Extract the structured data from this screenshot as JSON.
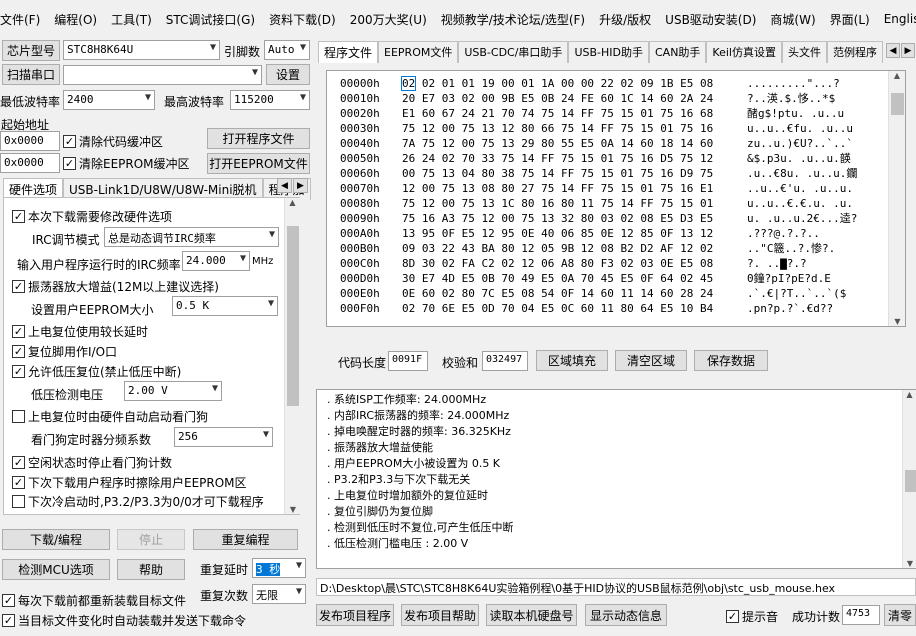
{
  "menu": [
    "文件(F)",
    "编程(O)",
    "工具(T)",
    "STC调试接口(G)",
    "资料下载(D)",
    "200万大奖(U)",
    "视频教学/技术论坛/选型(F)",
    "升级/版权",
    "USB驱动安装(D)",
    "商城(W)",
    "界面(L)",
    "English"
  ],
  "left": {
    "chip_btn": "芯片型号",
    "chip_val": "STC8H8K64U",
    "pins_lbl": "引脚数",
    "pins_val": "Auto",
    "scan_btn": "扫描串口",
    "port_val": "",
    "settings_btn": "设置",
    "min_baud_lbl": "最低波特率",
    "min_baud": "2400",
    "max_baud_lbl": "最高波特率",
    "max_baud": "115200",
    "start_addr_lbl": "起始地址",
    "addr1": "0x0000",
    "clear_code": "清除代码缓冲区",
    "open_prog": "打开程序文件",
    "addr2": "0x0000",
    "clear_eeprom": "清除EEPROM缓冲区",
    "open_eeprom": "打开EEPROM文件",
    "tabs": [
      "硬件选项",
      "USB-Link1D/U8W/U8W-Mini脱机",
      "程序加"
    ],
    "opts": {
      "o1": "本次下载需要修改硬件选项",
      "irc_mode_lbl": "IRC调节模式",
      "irc_mode": "总是动态调节IRC频率",
      "irc_freq_lbl": "输入用户程序运行时的IRC频率",
      "irc_freq": "24.000",
      "mhz": "MHz",
      "o2": "振荡器放大增益(12M以上建议选择)",
      "eeprom_size_lbl": "设置用户EEPROM大小",
      "eeprom_size": "0.5 K",
      "o3": "上电复位使用较长延时",
      "o4": "复位脚用作I/O口",
      "o5": "允许低压复位(禁止低压中断)",
      "lv_lbl": "低压检测电压",
      "lv": "2.00 V",
      "o6": "上电复位时由硬件自动启动看门狗",
      "wdt_lbl": "看门狗定时器分频系数",
      "wdt": "256",
      "o7": "空闲状态时停止看门狗计数",
      "o8": "下次下载用户程序时擦除用户EEPROM区",
      "o9": "下次冷启动时,P3.2/P3.3为0/0才可下载程序"
    },
    "download_btn": "下载/编程",
    "stop_btn": "停止",
    "reprog_btn": "重复编程",
    "detect_btn": "检测MCU选项",
    "help_btn": "帮助",
    "delay_lbl": "重复延时",
    "delay_val": "3 秒",
    "count_lbl": "重复次数",
    "count_val": "无限",
    "reload_each": "每次下载前都重新装载目标文件",
    "auto_send": "当目标文件变化时自动装载并发送下载命令"
  },
  "right": {
    "tabs": [
      "程序文件",
      "EEPROM文件",
      "USB-CDC/串口助手",
      "USB-HID助手",
      "CAN助手",
      "Keil仿真设置",
      "头文件",
      "范例程序"
    ],
    "hex_rows": [
      {
        "a": "00000h",
        "b": "02 02 01 01 19 00 01 1A 00 00 22 02 09 1B E5 08",
        "c": ".........\"...?"
      },
      {
        "a": "00010h",
        "b": "20 E7 03 02 00 9B E5 0B 24 FE 60 1C 14 60 2A 24",
        "c": " ?..渶.$.恀..*$"
      },
      {
        "a": "00020h",
        "b": "E1 60 67 24 21 70 74 75 14 FF 75 15 01 75 16 68",
        "c": "醏g$!ptu. .u..u"
      },
      {
        "a": "00030h",
        "b": "75 12 00 75 13 12 80 66 75 14 FF 75 15 01 75 16",
        "c": "u..u..€fu. .u..u"
      },
      {
        "a": "00040h",
        "b": "7A 75 12 00 75 13 29 80 55 E5 0A 14 60 18 14 60",
        "c": "zu..u.)€U?..`..`"
      },
      {
        "a": "00050h",
        "b": "26 24 02 70 33 75 14 FF 75 15 01 75 16 D5 75 12",
        "c": "&$.p3u. .u..u.韺"
      },
      {
        "a": "00060h",
        "b": "00 75 13 04 80 38 75 14 FF 75 15 01 75 16 D9 75",
        "c": ".u..€8u. .u..u.鑭"
      },
      {
        "a": "00070h",
        "b": "12 00 75 13 08 80 27 75 14 FF 75 15 01 75 16 E1",
        "c": "..u..€'u. .u..u."
      },
      {
        "a": "00080h",
        "b": "75 12 00 75 13 1C 80 16 80 11 75 14 FF 75 15 01",
        "c": "u..u..€.€.u. .u."
      },
      {
        "a": "00090h",
        "b": "75 16 A3 75 12 00 75 13 32 80 03 02 08 E5 D3 E5",
        "c": "u. .u..u.2€...逵?"
      },
      {
        "a": "000A0h",
        "b": "13 95 0F E5 12 95 0E 40 06 85 0E 12 85 0F 13 12",
        "c": ".???@.?.?.."
      },
      {
        "a": "000B0h",
        "b": "09 03 22 43 BA 80 12 05 9B 12 08 B2 D2 AF 12 02",
        "c": "..\"C簚..?.惨?."
      },
      {
        "a": "000C0h",
        "b": "8D 30 02 FA C2 02 12 06 A8 80 F3 02 03 0E E5 08",
        "c": "?.  ..▇?.?"
      },
      {
        "a": "000D0h",
        "b": "30 E7 4D E5 0B 70 49 E5 0A 70 45 E5 0F 64 02 45",
        "c": "0鐘?pI?pE?d.E"
      },
      {
        "a": "000E0h",
        "b": "0E 60 02 80 7C E5 08 54 0F 14 60 11 14 60 28 24",
        "c": ".`.€|?T..`..`($"
      },
      {
        "a": "000F0h",
        "b": "02 70 6E E5 0D 70 04 E5 0C 60 11 80 64 E5 10 B4",
        "c": ".pn?p.?`.€d??"
      }
    ],
    "code_len_lbl": "代码长度",
    "code_len": "0091F",
    "checksum_lbl": "校验和",
    "checksum": "032497",
    "fill_btn": "区域填充",
    "clear_btn": "清空区域",
    "save_btn": "保存数据",
    "log": [
      "系统ISP工作频率: 24.000MHz",
      "内部IRC振荡器的频率: 24.000MHz",
      "掉电唤醒定时器的频率: 36.325KHz",
      "振荡器放大增益使能",
      "用户EEPROM大小被设置为 0.5 K",
      "P3.2和P3.3与下次下载无关",
      "上电复位时增加额外的复位延时",
      "复位引脚仍为复位脚",
      "检测到低压时不复位,可产生低压中断",
      "低压检测门槛电压 : 2.00 V"
    ],
    "path": "D:\\Desktop\\晨\\STC\\STC8H8K64U实验箱例程\\0基于HID协议的USB鼠标范例\\obj\\stc_usb_mouse.hex",
    "publish_prog": "发布项目程序",
    "publish_help": "发布项目帮助",
    "read_disk": "读取本机硬盘号",
    "show_dyn": "显示动态信息",
    "beep": "提示音",
    "success_lbl": "成功计数",
    "success_val": "4753",
    "clear_count": "清零"
  }
}
